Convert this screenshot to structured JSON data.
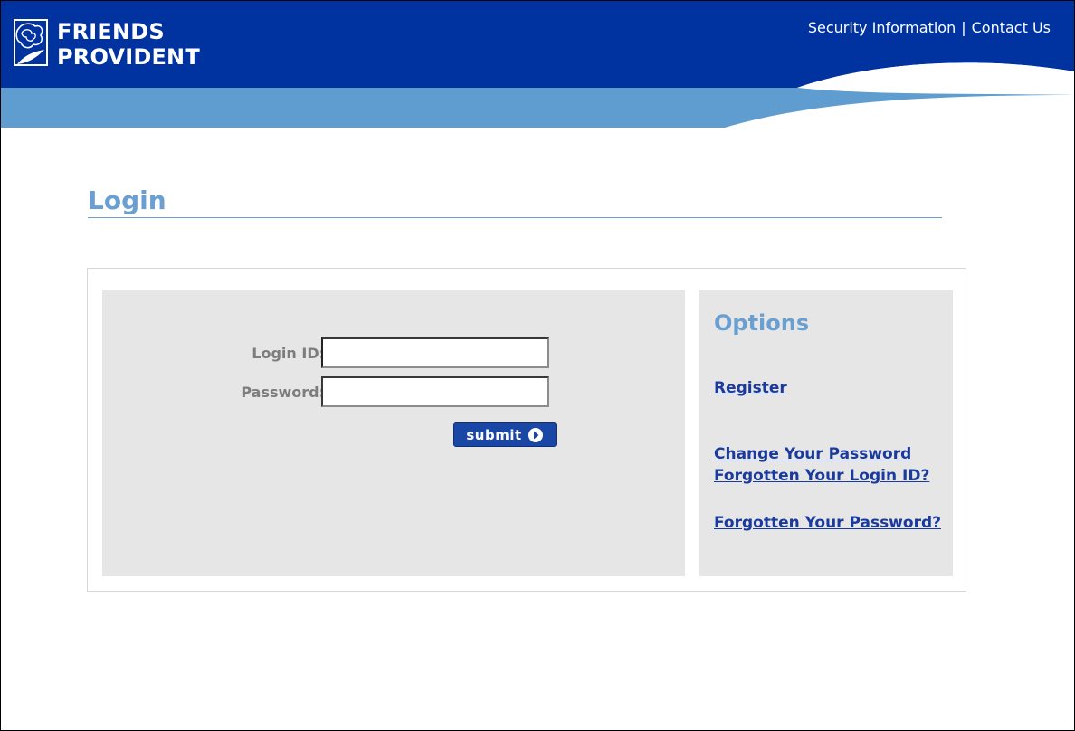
{
  "brand": {
    "line1": "FRIENDS",
    "line2": "PROVIDENT",
    "logo_icon": "rose-logo-icon",
    "primary_color": "#0033a0",
    "secondary_color": "#6a9fd2"
  },
  "top_nav": {
    "security_label": "Security Information",
    "separator": "|",
    "contact_label": "Contact Us"
  },
  "page": {
    "title": "Login"
  },
  "login_form": {
    "login_id_label": "Login ID:",
    "login_id_value": "",
    "password_label": "Password:",
    "password_value": "",
    "submit_label": "submit",
    "submit_icon": "arrow-right-circle-icon"
  },
  "options": {
    "title": "Options",
    "register": "Register",
    "change_password": "Change Your Password",
    "forgotten_login": "Forgotten Your Login ID?",
    "forgotten_password": "Forgotten Your Password?"
  }
}
